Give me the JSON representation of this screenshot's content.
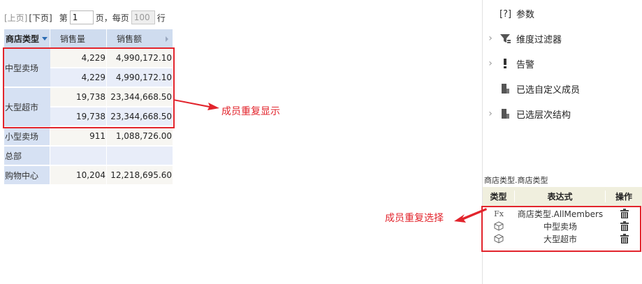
{
  "pager": {
    "prev": "[上页]",
    "next": "[下页]",
    "page_prefix": "第",
    "page_value": "1",
    "page_suffix": "页，每页",
    "page_size": "100",
    "row_suffix": "行"
  },
  "pivot": {
    "headers": [
      "商店类型",
      "销售量",
      "销售额"
    ],
    "rows": [
      {
        "dim": "中型卖场",
        "sales_qty": "4,229",
        "sales_amt": "4,990,172.10"
      },
      {
        "dim": "中型卖场",
        "sales_qty": "4,229",
        "sales_amt": "4,990,172.10"
      },
      {
        "dim": "大型超市",
        "sales_qty": "19,738",
        "sales_amt": "23,344,668.50"
      },
      {
        "dim": "大型超市",
        "sales_qty": "19,738",
        "sales_amt": "23,344,668.50"
      },
      {
        "dim": "小型卖场",
        "sales_qty": "911",
        "sales_amt": "1,088,726.00"
      },
      {
        "dim": "总部",
        "sales_qty": "",
        "sales_amt": ""
      },
      {
        "dim": "购物中心",
        "sales_qty": "10,204",
        "sales_amt": "12,218,695.60"
      }
    ]
  },
  "annotations": {
    "table_note": "成员重复显示",
    "expr_note": "成员重复选择",
    "color": "#e2242c"
  },
  "panel": {
    "items": [
      {
        "label": "参数",
        "icon": "help-bracket-icon",
        "has_chevron": false
      },
      {
        "label": "维度过滤器",
        "icon": "filter-icon",
        "has_chevron": true
      },
      {
        "label": "告警",
        "icon": "alert-icon",
        "has_chevron": true
      },
      {
        "label": "已选自定义成员",
        "icon": "member-icon",
        "has_chevron": false
      },
      {
        "label": "已选层次结构",
        "icon": "hierarchy-icon",
        "has_chevron": true
      }
    ],
    "expr_title": "商店类型.商店类型",
    "expr_headers": [
      "类型",
      "表达式",
      "操作"
    ],
    "expr_rows": [
      {
        "type_icon": "function-icon",
        "type_text": "Fx",
        "expr": "商店类型.AllMembers",
        "action_icon": "trash-icon"
      },
      {
        "type_icon": "cube-icon",
        "type_text": "",
        "expr": "中型卖场",
        "action_icon": "trash-icon"
      },
      {
        "type_icon": "cube-icon",
        "type_text": "",
        "expr": "大型超市",
        "action_icon": "trash-icon"
      }
    ]
  }
}
